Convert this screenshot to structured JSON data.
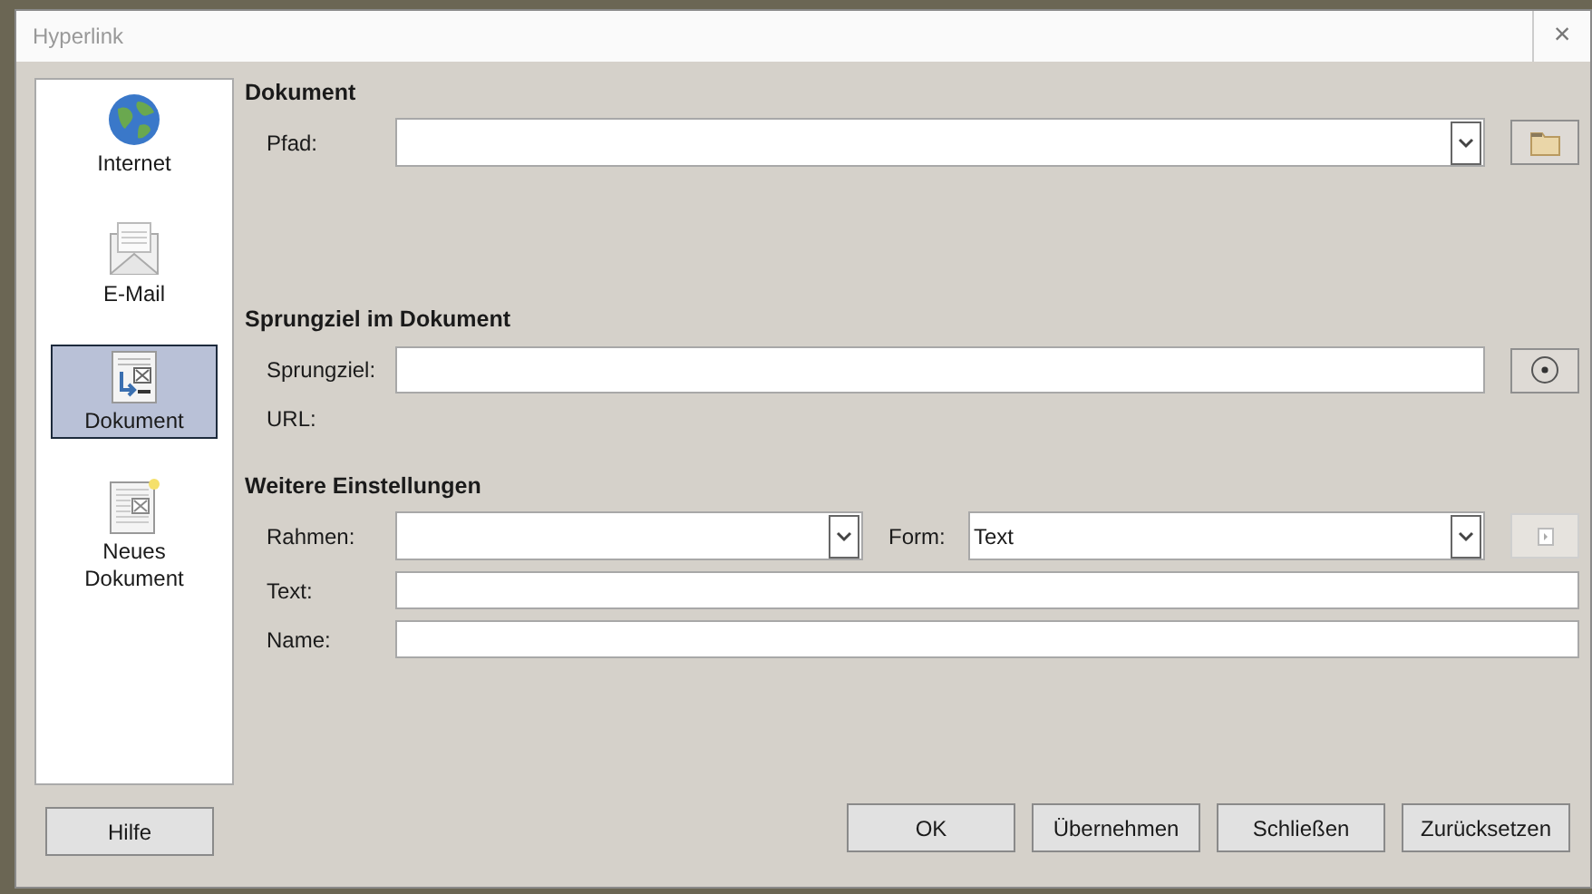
{
  "window": {
    "title": "Hyperlink",
    "close": "×"
  },
  "sidebar": {
    "items": [
      {
        "label": "Internet",
        "kind": "globe",
        "selected": false
      },
      {
        "label": "E-Mail",
        "kind": "mail",
        "selected": false
      },
      {
        "label": "Dokument",
        "kind": "document",
        "selected": true
      },
      {
        "label": "Neues Dokument",
        "kind": "new-document",
        "selected": false
      }
    ]
  },
  "sections": [
    {
      "heading": "Dokument",
      "rows": [
        {
          "kind": "combo-button",
          "label": "Pfad:",
          "value": "",
          "button": {
            "kind": "folder",
            "disabled": false
          }
        }
      ]
    },
    {
      "heading": "Sprungziel im Dokument",
      "rows": [
        {
          "kind": "text-button",
          "label": "Sprungziel:",
          "value": "",
          "button": {
            "kind": "target",
            "disabled": false
          }
        },
        {
          "kind": "label",
          "label": "URL:"
        }
      ]
    },
    {
      "heading": "Weitere Einstellungen",
      "rows": [
        {
          "kind": "two-combos",
          "label": "Rahmen:",
          "value": "",
          "label2": "Form:",
          "value2": "Text",
          "button": {
            "kind": "events",
            "disabled": true
          }
        },
        {
          "kind": "text",
          "label": "Text:",
          "value": ""
        },
        {
          "kind": "text",
          "label": "Name:",
          "value": ""
        }
      ]
    }
  ],
  "buttons": {
    "left": [
      "Hilfe"
    ],
    "right": [
      "OK",
      "Übernehmen",
      "Schließen",
      "Zurücksetzen"
    ]
  }
}
